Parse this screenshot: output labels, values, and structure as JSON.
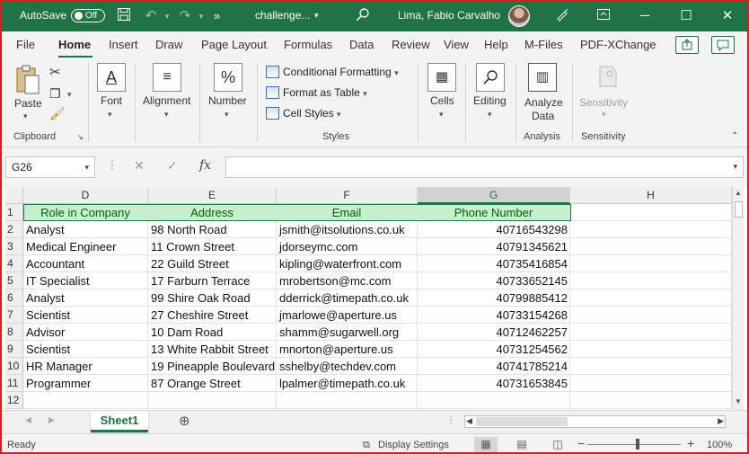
{
  "titlebar": {
    "autosave_label": "AutoSave",
    "autosave_state": "Off",
    "filename": "challenge...",
    "user": "Lima, Fabio Carvalho",
    "more": "»"
  },
  "tabs": [
    "File",
    "Home",
    "Insert",
    "Draw",
    "Page Layout",
    "Formulas",
    "Data",
    "Review",
    "View",
    "Help",
    "M-Files",
    "PDF-XChange"
  ],
  "active_tab": "Home",
  "ribbon": {
    "clipboard": {
      "paste": "Paste",
      "group": "Clipboard"
    },
    "font": "Font",
    "alignment": "Alignment",
    "number": "Number",
    "styles": {
      "conditional": "Conditional Formatting",
      "table": "Format as Table",
      "cell_styles": "Cell Styles",
      "group": "Styles"
    },
    "cells": "Cells",
    "editing": "Editing",
    "analysis": {
      "button_line1": "Analyze",
      "button_line2": "Data",
      "group": "Analysis"
    },
    "sensitivity": {
      "button": "Sensitivity",
      "group": "Sensitivity"
    }
  },
  "formula_bar": {
    "name_box": "G26",
    "fx": "fx",
    "value": ""
  },
  "grid": {
    "columns": [
      "D",
      "E",
      "F",
      "G",
      "H"
    ],
    "selected_column": "G",
    "rows": [
      "1",
      "2",
      "3",
      "4",
      "5",
      "6",
      "7",
      "8",
      "9",
      "10",
      "11",
      "12"
    ],
    "header": [
      "Role in Company",
      "Address",
      "Email",
      "Phone Number"
    ],
    "data": [
      [
        "Analyst",
        "98 North Road",
        "jsmith@itsolutions.co.uk",
        "40716543298"
      ],
      [
        "Medical Engineer",
        "11 Crown Street",
        "jdorseymc.com",
        "40791345621"
      ],
      [
        "Accountant",
        "22 Guild Street",
        "kipling@waterfront.com",
        "40735416854"
      ],
      [
        "IT Specialist",
        "17 Farburn Terrace",
        "mrobertson@mc.com",
        "40733652145"
      ],
      [
        "Analyst",
        "99 Shire Oak Road",
        "dderrick@timepath.co.uk",
        "40799885412"
      ],
      [
        "Scientist",
        "27 Cheshire Street",
        "jmarlowe@aperture.us",
        "40733154268"
      ],
      [
        "Advisor",
        "10 Dam Road",
        "shamm@sugarwell.org",
        "40712462257"
      ],
      [
        "Scientist",
        "13 White Rabbit Street",
        "mnorton@aperture.us",
        "40731254562"
      ],
      [
        "HR Manager",
        "19 Pineapple Boulevard",
        "sshelby@techdev.com",
        "40741785214"
      ],
      [
        "Programmer",
        "87 Orange Street",
        "lpalmer@timepath.co.uk",
        "40731653845"
      ]
    ]
  },
  "sheets": [
    "Sheet1"
  ],
  "status": {
    "ready": "Ready",
    "display_settings": "Display Settings",
    "zoom": "100%"
  },
  "colors": {
    "excel_green": "#217346",
    "header_fill": "#c6efce",
    "header_text": "#006100"
  }
}
